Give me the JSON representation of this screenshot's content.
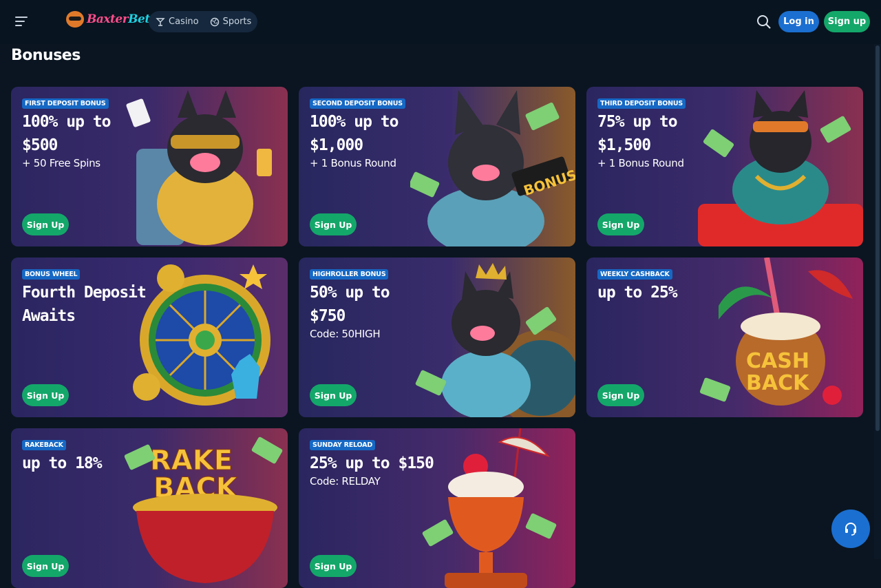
{
  "header": {
    "logo_text_a": "Baxter",
    "logo_text_b": "Bet",
    "nav": [
      {
        "label": "Casino",
        "icon": "cocktail-icon"
      },
      {
        "label": "Sports",
        "icon": "ball-icon"
      }
    ],
    "login_label": "Log in",
    "signup_label": "Sign up"
  },
  "page": {
    "title": "Bonuses"
  },
  "cards": [
    {
      "badge": "FIRST DEPOSIT BONUS",
      "headline_1": "100% up to",
      "headline_2": "$500",
      "sub": "+ 50 Free Spins",
      "button": "Sign Up"
    },
    {
      "badge": "SECOND DEPOSIT BONUS",
      "headline_1": "100% up to",
      "headline_2": "$1,000",
      "sub": "+ 1 Bonus Round",
      "button": "Sign Up"
    },
    {
      "badge": "THIRD DEPOSIT BONUS",
      "headline_1": "75% up to",
      "headline_2": "$1,500",
      "sub": "+ 1 Bonus Round",
      "button": "Sign Up"
    },
    {
      "badge": "BONUS WHEEL",
      "headline_1": "Fourth Deposit",
      "headline_2": "Awaits",
      "sub": "",
      "button": "Sign Up"
    },
    {
      "badge": "HIGHROLLER BONUS",
      "headline_1": "50% up to",
      "headline_2": "$750",
      "sub": "Code: 50HIGH",
      "button": "Sign Up"
    },
    {
      "badge": "WEEKLY CASHBACK",
      "headline_1": "up to 25%",
      "headline_2": "",
      "sub": "",
      "button": "Sign Up",
      "art_text_1": "CASH",
      "art_text_2": "BACK"
    },
    {
      "badge": "RAKEBACK",
      "headline_1": "up to 18%",
      "headline_2": "",
      "sub": "",
      "button": "Sign Up",
      "art_text_1": "RAKE",
      "art_text_2": "BACK"
    },
    {
      "badge": "SUNDAY RELOAD",
      "headline_1": "25% up to $150",
      "headline_2": "",
      "sub": "Code: RELDAY",
      "button": "Sign Up"
    }
  ],
  "art_labels": {
    "bonus_sign": "BONUS"
  },
  "colors": {
    "accent_green": "#14a76a",
    "accent_blue": "#1b6fd0",
    "badge_blue": "#1668c4",
    "background": "#0a1521"
  }
}
